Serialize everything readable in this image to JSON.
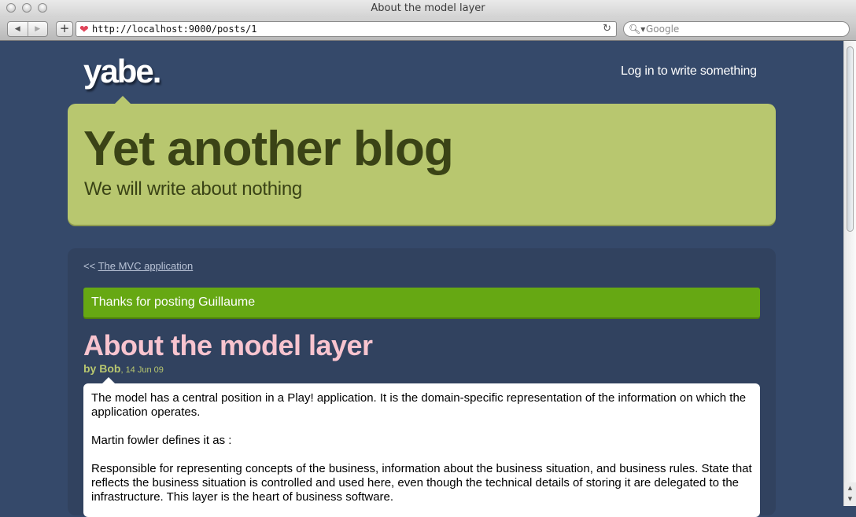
{
  "window": {
    "title": "About the model layer"
  },
  "toolbar": {
    "back_icon": "◀",
    "forward_icon": "▶",
    "add_label": "+",
    "url": "http://localhost:9000/posts/1",
    "reload_icon": "↻",
    "search_placeholder": "Google",
    "search_icon": "🔍︎▾"
  },
  "site": {
    "logo": "yabe.",
    "login_link": "Log in to write something",
    "title": "Yet another blog",
    "description": "We will write about nothing"
  },
  "navigation": {
    "prev_marker": "<<",
    "prev_post_title": "The MVC application"
  },
  "flash": {
    "message": "Thanks for posting Guillaume"
  },
  "post": {
    "title": "About the model layer",
    "author": "by Bob",
    "date": ", 14 Jun 09",
    "paragraphs": [
      "The model has a central position in a Play! application. It is the domain-specific representation of the information on which the application operates.",
      "Martin fowler defines it as :",
      "Responsible for representing concepts of the business, information about the business situation, and business rules. State that reflects the business situation is controlled and used here, even though the technical details of storing it are delegated to the infrastructure. This layer is the heart of business software."
    ]
  },
  "colors": {
    "page_background": "#35496a",
    "header_background": "#b8c76f",
    "flash_background": "#66a813",
    "post_title": "#f8c4cf"
  }
}
